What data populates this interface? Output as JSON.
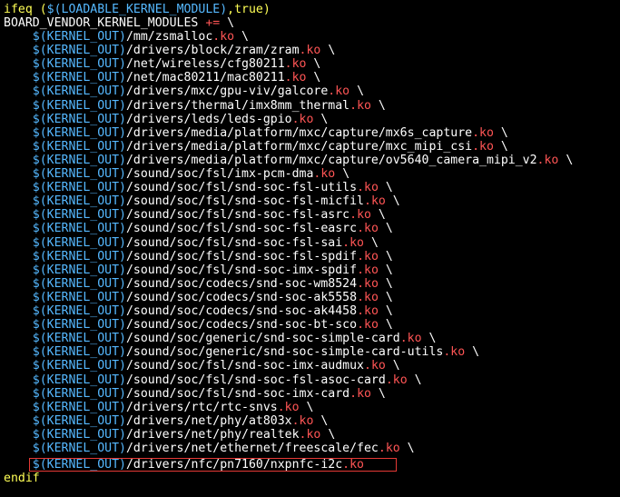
{
  "editor": {
    "header": {
      "ifeq": "ifeq",
      "cond_open": " (",
      "cond_var": "$(LOADABLE_KERNEL_MODULE)",
      "cond_rest": ",true)",
      "assign_var": "BOARD_VENDOR_KERNEL_MODULES",
      "assign_op": " +=",
      "assign_tail": " \\"
    },
    "var_prefix": "$(KERNEL_OUT)",
    "ext": ".ko",
    "continuation": " \\",
    "entries": [
      "/mm/zsmalloc",
      "/drivers/block/zram/zram",
      "/net/wireless/cfg80211",
      "/net/mac80211/mac80211",
      "/drivers/mxc/gpu-viv/galcore",
      "/drivers/thermal/imx8mm_thermal",
      "/drivers/leds/leds-gpio",
      "/drivers/media/platform/mxc/capture/mx6s_capture",
      "/drivers/media/platform/mxc/capture/mxc_mipi_csi",
      "/drivers/media/platform/mxc/capture/ov5640_camera_mipi_v2",
      "/sound/soc/fsl/imx-pcm-dma",
      "/sound/soc/fsl/snd-soc-fsl-utils",
      "/sound/soc/fsl/snd-soc-fsl-micfil",
      "/sound/soc/fsl/snd-soc-fsl-asrc",
      "/sound/soc/fsl/snd-soc-fsl-easrc",
      "/sound/soc/fsl/snd-soc-fsl-sai",
      "/sound/soc/fsl/snd-soc-fsl-spdif",
      "/sound/soc/fsl/snd-soc-imx-spdif",
      "/sound/soc/codecs/snd-soc-wm8524",
      "/sound/soc/codecs/snd-soc-ak5558",
      "/sound/soc/codecs/snd-soc-ak4458",
      "/sound/soc/codecs/snd-soc-bt-sco",
      "/sound/soc/generic/snd-soc-simple-card",
      "/sound/soc/generic/snd-soc-simple-card-utils",
      "/sound/soc/fsl/snd-soc-imx-audmux",
      "/sound/soc/fsl/snd-soc-fsl-asoc-card",
      "/sound/soc/fsl/snd-soc-imx-card",
      "/drivers/rtc/rtc-snvs",
      "/drivers/net/phy/at803x",
      "/drivers/net/phy/realtek",
      "/drivers/net/ethernet/freescale/fec"
    ],
    "last_entry": "/drivers/nfc/pn7160/nxpnfc-i2c",
    "footer": "endif"
  },
  "colors": {
    "background": "#000000",
    "keyword": "#ffff55",
    "variable": "#55b8ff",
    "extension": "#ff5555",
    "highlight_box": "#e53935"
  }
}
